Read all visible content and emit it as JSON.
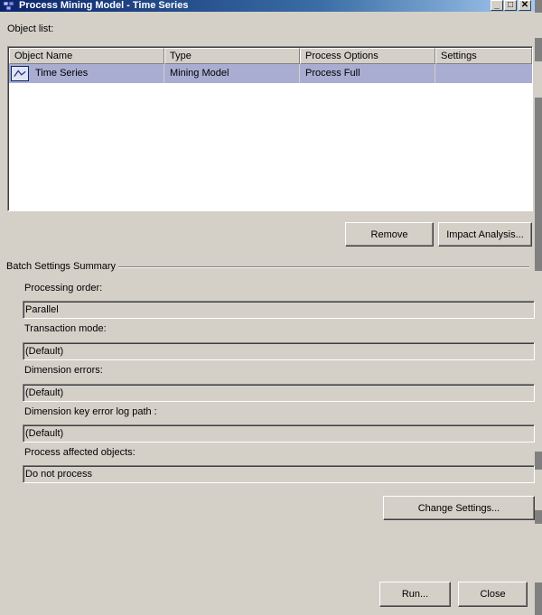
{
  "window": {
    "title": "Process Mining Model - Time Series",
    "minimize_glyph": "_",
    "maximize_glyph": "□",
    "close_glyph": "✕"
  },
  "object_list": {
    "label": "Object list:",
    "columns": [
      "Object Name",
      "Type",
      "Process Options",
      "Settings"
    ],
    "rows": [
      {
        "icon": "time-series-model-icon",
        "object_name": "Time Series",
        "type": "Mining Model",
        "process_options": "Process Full",
        "settings": ""
      }
    ]
  },
  "buttons": {
    "remove": "Remove",
    "impact_analysis": "Impact Analysis...",
    "change_settings": "Change Settings...",
    "run": "Run...",
    "close": "Close"
  },
  "batch_settings": {
    "heading": "Batch Settings Summary",
    "processing_order_label": "Processing order:",
    "processing_order_value": "Parallel",
    "transaction_mode_label": "Transaction mode:",
    "transaction_mode_value": "(Default)",
    "dimension_errors_label": "Dimension errors:",
    "dimension_errors_value": "(Default)",
    "dimension_key_error_log_path_label": "Dimension key error log path :",
    "dimension_key_error_log_path_value": "(Default)",
    "process_affected_objects_label": "Process affected objects:",
    "process_affected_objects_value": "Do not process"
  },
  "colors": {
    "dialog_background": "#d4d0c8",
    "title_bar_start": "#0a246a",
    "title_bar_end": "#a6caf0",
    "selected_row": "#a9add1"
  }
}
